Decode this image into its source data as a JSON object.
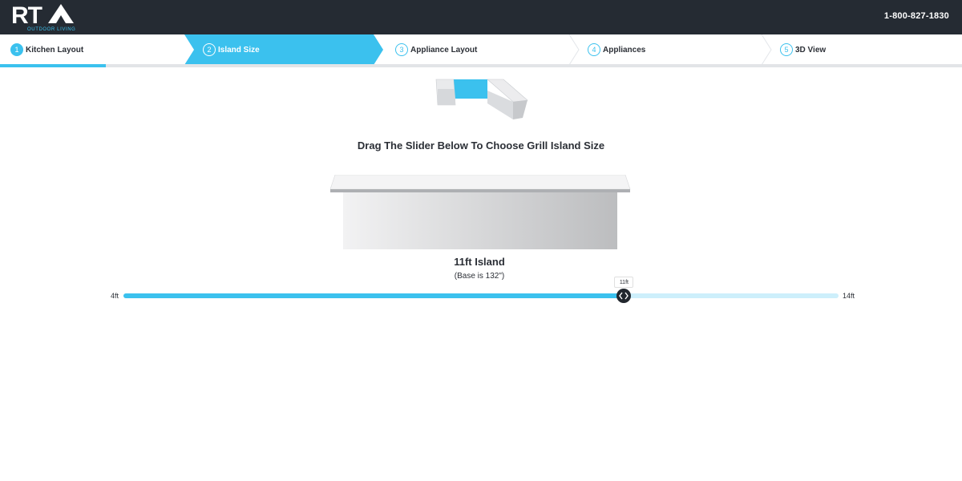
{
  "header": {
    "logo_text": "RTA",
    "logo_subtext": "OUTDOOR LIVING",
    "phone": "1-800-827-1830"
  },
  "steps": [
    {
      "number": "1",
      "label": "Kitchen Layout",
      "state": "done"
    },
    {
      "number": "2",
      "label": "Island Size",
      "state": "active"
    },
    {
      "number": "3",
      "label": "Appliance Layout",
      "state": "todo"
    },
    {
      "number": "4",
      "label": "Appliances",
      "state": "todo"
    },
    {
      "number": "5",
      "label": "3D View",
      "state": "todo"
    }
  ],
  "progress_fraction": 0.11,
  "instruction": "Drag The Slider Below To Choose Grill Island Size",
  "size": {
    "title": "11ft Island",
    "subtitle": "(Base is 132\")"
  },
  "slider": {
    "min": 4,
    "max": 14,
    "value": 11,
    "min_label": "4ft",
    "max_label": "14ft",
    "value_label": "11ft"
  },
  "colors": {
    "accent": "#3bc1ee",
    "header_bg": "#252b33",
    "track_light": "#cdeffb"
  },
  "icons": {
    "handle": "chevron-left-right-icon"
  }
}
